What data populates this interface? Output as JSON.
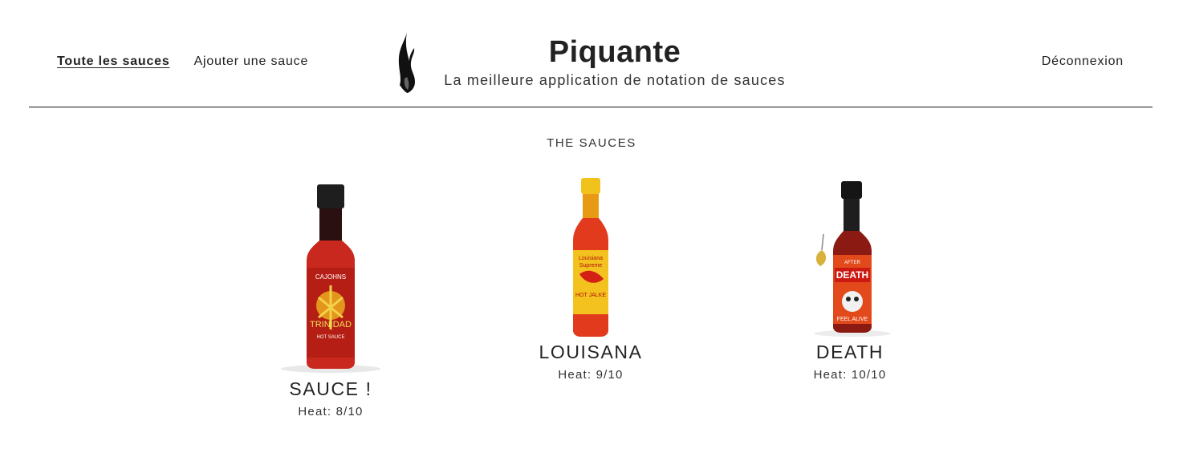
{
  "nav": {
    "all_sauces": "Toute les sauces",
    "add_sauce": "Ajouter une sauce",
    "logout": "Déconnexion"
  },
  "brand": {
    "title": "Piquante",
    "subtitle": "La meilleure application de notation de sauces",
    "logo_icon": "flame-icon"
  },
  "section": {
    "title": "THE SAUCES"
  },
  "sauces": [
    {
      "name": "SAUCE !",
      "heat_label": "Heat:",
      "heat": "8/10",
      "bottle_label": "CAJOHNS TRINIDAD HOT SAUCE",
      "color": "#c8281e"
    },
    {
      "name": "LOUISANA",
      "heat_label": "Heat:",
      "heat": "9/10",
      "bottle_label": "Louisiana Supreme HOT JALKE",
      "color": "#e23a1c"
    },
    {
      "name": "DEATH",
      "heat_label": "Heat:",
      "heat": "10/10",
      "bottle_label": "AFTER DEATH FEEL ALIVE",
      "color": "#d8251e"
    }
  ],
  "colors": {
    "accent": "#222222",
    "divider": "#111111",
    "background": "#ffffff"
  }
}
